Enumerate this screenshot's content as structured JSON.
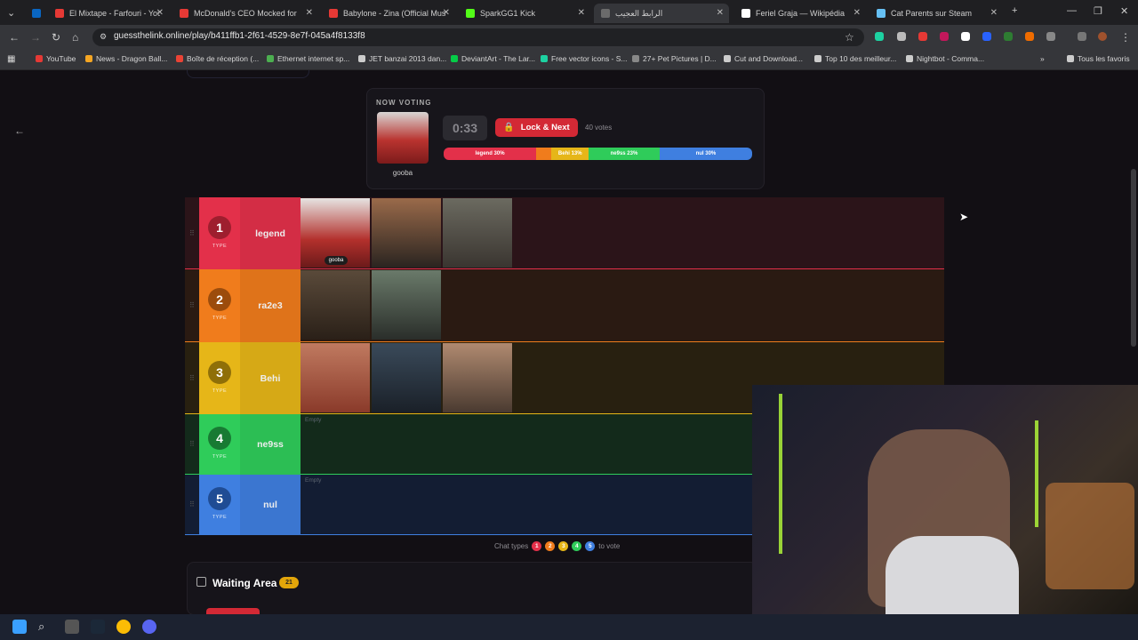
{
  "browser": {
    "tabs": [
      {
        "title": "El Mixtape - Farfouri - You",
        "color": "#e53935"
      },
      {
        "title": "McDonald's CEO Mocked for",
        "color": "#e53935"
      },
      {
        "title": "Babylone - Zina (Official Musi",
        "color": "#e53935"
      },
      {
        "title": "SparkGG1 Kick",
        "color": "#53fc18"
      },
      {
        "title": "الرابط العجيب",
        "color": "#6b6b6b"
      },
      {
        "title": "Feriel Graja — Wikipédia",
        "color": "#ffffff"
      },
      {
        "title": "Cat Parents sur Steam",
        "color": "#66c0f4"
      }
    ],
    "new_tab_label": "+",
    "url": "guessthelink.online/play/b411ffb1-2f61-4529-8e7f-045a4f8133f8",
    "bookmarks": [
      {
        "label": "YouTube",
        "color": "#e53935"
      },
      {
        "label": "News - Dragon Ball...",
        "color": "#f5a623"
      },
      {
        "label": "Boîte de réception (...",
        "color": "#ea4335"
      },
      {
        "label": "Ethernet internet sp...",
        "color": "#4caf50"
      },
      {
        "label": "JET banzai 2013 dan...",
        "color": "#cccccc"
      },
      {
        "label": "DeviantArt - The Lar...",
        "color": "#05cc47"
      },
      {
        "label": "Free vector icons - S...",
        "color": "#1dd1a1"
      },
      {
        "label": "27+ Pet Pictures | D...",
        "color": "#888888"
      },
      {
        "label": "Cut and Download...",
        "color": "#cccccc"
      },
      {
        "label": "Top 10 des meilleur...",
        "color": "#cccccc"
      },
      {
        "label": "Nightbot - Comma...",
        "color": "#cccccc"
      }
    ],
    "all_bookmarks_label": "Tous les favoris"
  },
  "voting": {
    "label": "NOW VOTING",
    "name": "gooba",
    "timer": "0:33",
    "lock_label": "Lock & Next",
    "votes": "40 votes",
    "bar": [
      {
        "label": "legend 30%",
        "pct": 30,
        "color": "#e3304a"
      },
      {
        "label": "",
        "pct": 5,
        "color": "#f07c1c"
      },
      {
        "label": "Behi 13%",
        "pct": 12,
        "color": "#e6b618"
      },
      {
        "label": "ne9ss 23%",
        "pct": 23,
        "color": "#2fcc5a"
      },
      {
        "label": "nul 30%",
        "pct": 30,
        "color": "#3f7fe0"
      }
    ]
  },
  "tiers": [
    {
      "num": "1",
      "name": "legend",
      "type": "TYPE",
      "color": "#e3304a",
      "badge": "#9e1e2e",
      "row": "#2b1419",
      "line": "#e3304a",
      "images": 3,
      "empty": ""
    },
    {
      "num": "2",
      "name": "ra2e3",
      "type": "TYPE",
      "color": "#f07c1c",
      "badge": "#9c4c0c",
      "row": "#2a1a12",
      "line": "#f07c1c",
      "images": 2,
      "empty": ""
    },
    {
      "num": "3",
      "name": "Behi",
      "type": "TYPE",
      "color": "#e6b618",
      "badge": "#8f6f08",
      "row": "#282010",
      "line": "#e6b618",
      "images": 3,
      "empty": ""
    },
    {
      "num": "4",
      "name": "ne9ss",
      "type": "TYPE",
      "color": "#2fcc5a",
      "badge": "#187a33",
      "row": "#132a1b",
      "line": "#2fcc5a",
      "images": 0,
      "empty": "Empty"
    },
    {
      "num": "5",
      "name": "nul",
      "type": "TYPE",
      "color": "#3f7fe0",
      "badge": "#1f4c94",
      "row": "#131d33",
      "line": "#3f7fe0",
      "images": 0,
      "empty": "Empty"
    }
  ],
  "thumb_label": "gooba",
  "chat_hint": {
    "prefix": "Chat types",
    "suffix": "to vote",
    "nums": [
      "1",
      "2",
      "3",
      "4",
      "5"
    ]
  },
  "waiting": {
    "title": "Waiting Area",
    "count": "21"
  }
}
